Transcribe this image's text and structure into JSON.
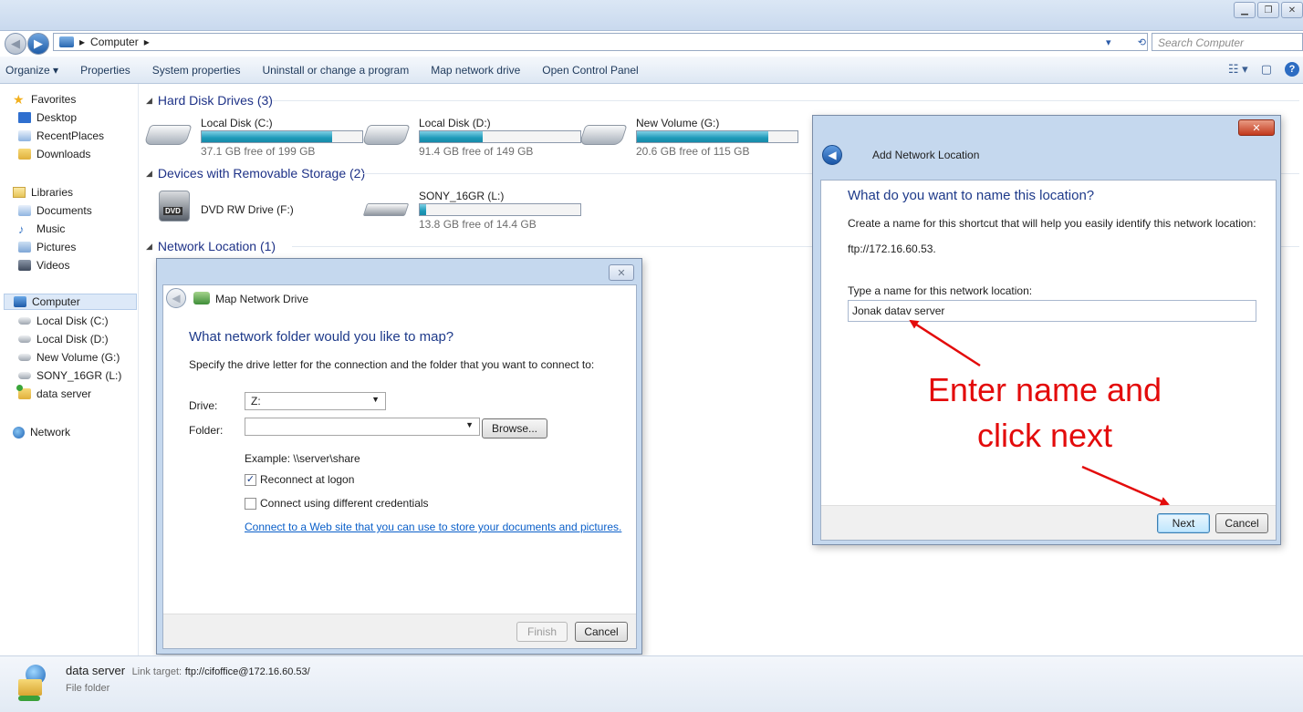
{
  "explorer": {
    "breadcrumb": [
      "Computer"
    ],
    "search_placeholder": "Search Computer",
    "toolbar": [
      "Organize ▾",
      "Properties",
      "System properties",
      "Uninstall or change a program",
      "Map network drive",
      "Open Control Panel"
    ],
    "sidebar": {
      "favorites": {
        "label": "Favorites",
        "items": [
          "Desktop",
          "RecentPlaces",
          "Downloads"
        ]
      },
      "libraries": {
        "label": "Libraries",
        "items": [
          "Documents",
          "Music",
          "Pictures",
          "Videos"
        ]
      },
      "computer": {
        "label": "Computer",
        "items": [
          "Local Disk (C:)",
          "Local Disk (D:)",
          "New Volume (G:)",
          "SONY_16GR (L:)",
          "data server"
        ]
      },
      "network": {
        "label": "Network"
      }
    },
    "groups": {
      "hard_disks": "Hard Disk Drives (3)",
      "removable": "Devices with Removable Storage (2)",
      "network": "Network Location (1)"
    },
    "drives": [
      {
        "name": "Local Disk (C:)",
        "free": "37.1 GB free of 199 GB",
        "used_fraction": 0.81
      },
      {
        "name": "Local Disk (D:)",
        "free": "91.4 GB free of 149 GB",
        "used_fraction": 0.39
      },
      {
        "name": "New Volume (G:)",
        "free": "20.6 GB free of 115 GB",
        "used_fraction": 0.82
      },
      {
        "name": "DVD RW Drive (F:)"
      },
      {
        "name": "SONY_16GR (L:)",
        "free": "13.8 GB free of 14.4 GB",
        "used_fraction": 0.04
      }
    ],
    "details": {
      "name": "data server",
      "link_label": "Link target:",
      "link_value": "ftp://cifoffice@172.16.60.53/",
      "type": "File folder"
    }
  },
  "map_dialog": {
    "title": "Map Network Drive",
    "heading": "What network folder would you like to map?",
    "instruction": "Specify the drive letter for the connection and the folder that you want to connect to:",
    "drive_label": "Drive:",
    "drive_value": "Z:",
    "folder_label": "Folder:",
    "folder_value": "",
    "browse": "Browse...",
    "example": "Example: \\\\server\\share",
    "reconnect": "Reconnect at logon",
    "reconnect_checked": true,
    "diff_creds": "Connect using different credentials",
    "diff_creds_checked": false,
    "link": "Connect to a Web site that you can use to store your documents and pictures.",
    "finish": "Finish",
    "cancel": "Cancel"
  },
  "add_dialog": {
    "title": "Add Network Location",
    "heading": "What do you want to name this location?",
    "instruction": "Create a name for this shortcut that will help you easily identify this network location:",
    "address": "ftp://172.16.60.53.",
    "name_label": "Type a name for this network location:",
    "name_value": "Jonak datav server",
    "next": "Next",
    "cancel": "Cancel"
  },
  "annotation": {
    "line1": "Enter name and",
    "line2": "click next",
    "color": "#e30b0b"
  },
  "colors": {
    "heading_blue": "#1e3a8a",
    "link_blue": "#0a5fc9",
    "bar_fill": "#1f9ab9"
  }
}
